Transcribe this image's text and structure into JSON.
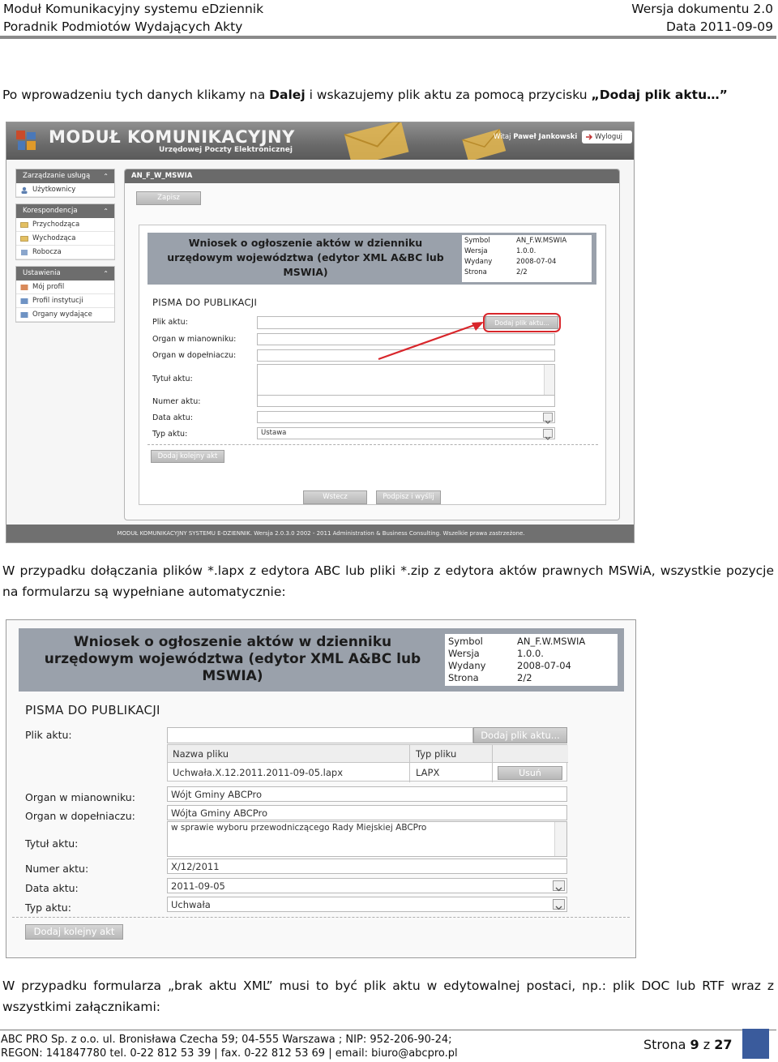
{
  "doc_header": {
    "title": "Moduł Komunikacyjny systemu eDziennik",
    "subtitle": "Poradnik Podmiotów Wydających Akty",
    "version": "Wersja dokumentu 2.0",
    "date": "Data 2011-09-09"
  },
  "para1": {
    "pre": "Po wprowadzeniu tych danych klikamy na ",
    "dalej": "Dalej",
    "mid": " i wskazujemy plik aktu za pomocą przycisku ",
    "quoted": "„Dodaj plik aktu…”"
  },
  "para2": "W przypadku dołączania plików *.lapx z edytora ABC lub pliki *.zip z edytora aktów prawnych MSWiA, wszystkie pozycje na formularzu są wypełniane automatycznie:",
  "para3": "W przypadku formularza „brak aktu XML” musi to być plik aktu w edytowalnej postaci, np.: plik DOC lub RTF wraz z wszystkimi załącznikami:",
  "app": {
    "title": "MODUŁ KOMUNIKACYJNY",
    "subtitle": "Urzędowej Poczty Elektronicznej",
    "welcome_pre": "Witaj ",
    "welcome_user": "Paweł Jankowski",
    "logout": "Wyloguj",
    "sidebar": [
      {
        "label": "Zarządzanie usługą",
        "items": [
          "Użytkownicy"
        ]
      },
      {
        "label": "Korespondencja",
        "items": [
          "Przychodząca",
          "Wychodząca",
          "Robocza"
        ]
      },
      {
        "label": "Ustawienia",
        "items": [
          "Mój profil",
          "Profil instytucji",
          "Organy wydające"
        ]
      }
    ],
    "panel_title": "AN_F_W_MSWIA",
    "save": "Zapisz",
    "back": "Wstecz",
    "sign_send": "Podpisz i wyślij",
    "footer": "MODUŁ KOMUNIKACYJNY SYSTEMU E-DZIENNIK. Wersja 2.0.3.0 2002 - 2011 Administration & Business Consulting. Wszelkie prawa zastrzeżone."
  },
  "form": {
    "title": "Wniosek o ogłoszenie aktów w dzienniku urzędowym województwa (edytor XML A&BC lub MSWIA)",
    "meta": [
      {
        "k": "Symbol",
        "v": "AN_F.W.MSWIA"
      },
      {
        "k": "Wersja",
        "v": "1.0.0."
      },
      {
        "k": "Wydany",
        "v": "2008-07-04"
      },
      {
        "k": "Strona",
        "v": "2/2"
      }
    ],
    "section": "PISMA DO PUBLIKACJI",
    "labels": {
      "plik": "Plik aktu:",
      "organ_m": "Organ w mianowniku:",
      "organ_d": "Organ w dopełniaczu:",
      "tytul": "Tytuł aktu:",
      "numer": "Numer aktu:",
      "data": "Data aktu:",
      "typ": "Typ aktu:"
    },
    "add_file": "Dodaj plik aktu...",
    "add_next": "Dodaj kolejny akt",
    "typ_default": "Ustawa"
  },
  "filled": {
    "col_name": "Nazwa pliku",
    "col_type": "Typ pliku",
    "file_name": "Uchwała.X.12.2011.2011-09-05.lapx",
    "file_type": "LAPX",
    "remove": "Usuń",
    "organ_m": "Wójt Gminy ABCPro",
    "organ_d": "Wójta Gminy ABCPro",
    "tytul": "w sprawie wyboru przewodniczącego Rady Miejskiej ABCPro",
    "numer": "X/12/2011",
    "data": "2011-09-05",
    "typ": "Uchwała"
  },
  "page_footer": {
    "line1": "ABC PRO Sp. z o.o. ul. Bronisława Czecha 59;  04-555 Warszawa ; NIP: 952-206-90-24;",
    "line2": "REGON: 141847780 tel. 0-22 812 53 39 | fax. 0-22 812 53 69 | email: biuro@abcpro.pl",
    "page_pre": "Strona ",
    "page_num": "9",
    "page_mid": " z ",
    "page_total": "27"
  },
  "colors": {
    "accent_block": "#3a5b9c",
    "highlight_red": "#d8262b",
    "meta_bar": "#9aa1ab"
  }
}
